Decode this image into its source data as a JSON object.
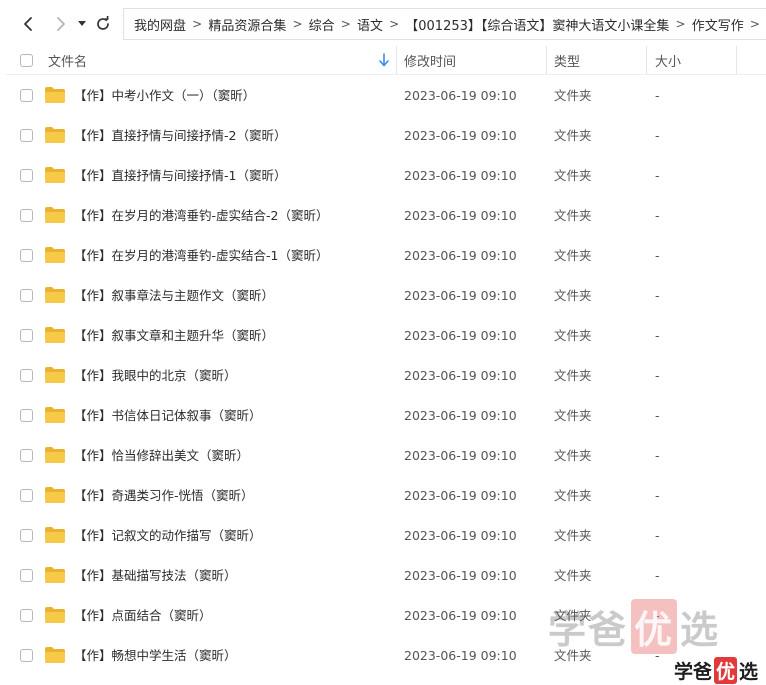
{
  "nav": {
    "back_icon": "chevron-left-icon",
    "forward_icon": "chevron-right-icon",
    "dropdown_icon": "caret-down-icon",
    "refresh_icon": "refresh-icon"
  },
  "breadcrumb": [
    "我的网盘",
    "精品资源合集",
    "综合",
    "语文",
    "【001253】【综合语文】窦神大语文小课全集",
    "作文写作"
  ],
  "breadcrumb_separator": ">",
  "columns": {
    "name": "文件名",
    "modified": "修改时间",
    "type": "类型",
    "size": "大小"
  },
  "sort": {
    "column": "name",
    "direction": "descending",
    "icon": "arrow-down-icon",
    "color": "#3a8ee6"
  },
  "folder_color": "#f7c948",
  "rows": [
    {
      "name": "【作】中考小作文（一）（窦昕）",
      "modified": "2023-06-19 09:10",
      "type": "文件夹",
      "size": "-"
    },
    {
      "name": "【作】直接抒情与间接抒情-2（窦昕）",
      "modified": "2023-06-19 09:10",
      "type": "文件夹",
      "size": "-"
    },
    {
      "name": "【作】直接抒情与间接抒情-1（窦昕）",
      "modified": "2023-06-19 09:10",
      "type": "文件夹",
      "size": "-"
    },
    {
      "name": "【作】在岁月的港湾垂钓-虚实结合-2（窦昕）",
      "modified": "2023-06-19 09:10",
      "type": "文件夹",
      "size": "-"
    },
    {
      "name": "【作】在岁月的港湾垂钓-虚实结合-1（窦昕）",
      "modified": "2023-06-19 09:10",
      "type": "文件夹",
      "size": "-"
    },
    {
      "name": "【作】叙事章法与主题作文（窦昕）",
      "modified": "2023-06-19 09:10",
      "type": "文件夹",
      "size": "-"
    },
    {
      "name": "【作】叙事文章和主题升华（窦昕）",
      "modified": "2023-06-19 09:10",
      "type": "文件夹",
      "size": "-"
    },
    {
      "name": "【作】我眼中的北京（窦昕）",
      "modified": "2023-06-19 09:10",
      "type": "文件夹",
      "size": "-"
    },
    {
      "name": "【作】书信体日记体叙事（窦昕）",
      "modified": "2023-06-19 09:10",
      "type": "文件夹",
      "size": "-"
    },
    {
      "name": "【作】恰当修辞出美文（窦昕）",
      "modified": "2023-06-19 09:10",
      "type": "文件夹",
      "size": "-"
    },
    {
      "name": "【作】奇遇类习作-恍悟（窦昕）",
      "modified": "2023-06-19 09:10",
      "type": "文件夹",
      "size": "-"
    },
    {
      "name": "【作】记叙文的动作描写（窦昕）",
      "modified": "2023-06-19 09:10",
      "type": "文件夹",
      "size": "-"
    },
    {
      "name": "【作】基础描写技法（窦昕）",
      "modified": "2023-06-19 09:10",
      "type": "文件夹",
      "size": "-"
    },
    {
      "name": "【作】点面结合（窦昕）",
      "modified": "2023-06-19 09:10",
      "type": "文件夹",
      "size": "-"
    },
    {
      "name": "【作】畅想中学生活（窦昕）",
      "modified": "2023-06-19 09:10",
      "type": "文件夹",
      "size": "-"
    }
  ],
  "watermark": {
    "large": [
      "学爸",
      "优",
      "选"
    ],
    "small": [
      "学爸",
      "优",
      "选"
    ]
  }
}
